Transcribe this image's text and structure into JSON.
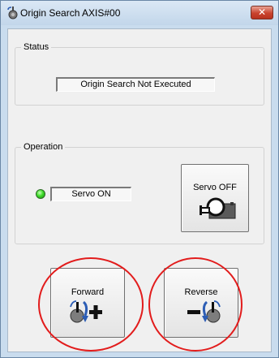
{
  "window": {
    "title": "Origin Search AXIS#00",
    "app_icon": "servo-motor-icon",
    "close_icon": "close-icon",
    "close_glyph": "✕"
  },
  "status_group": {
    "title": "Status",
    "status_text": "Origin Search Not Executed"
  },
  "operation_group": {
    "title": "Operation",
    "indicator_color": "#3fdc2a",
    "servo_state": "Servo ON",
    "servo_off_button": {
      "label": "Servo OFF",
      "icon": "servo-motor-icon"
    }
  },
  "jog_buttons": {
    "forward": {
      "label": "Forward",
      "icon": "forward-rotation-icon"
    },
    "reverse": {
      "label": "Reverse",
      "icon": "reverse-rotation-icon"
    }
  },
  "annotations": {
    "highlight_color": "#e21c1c"
  }
}
